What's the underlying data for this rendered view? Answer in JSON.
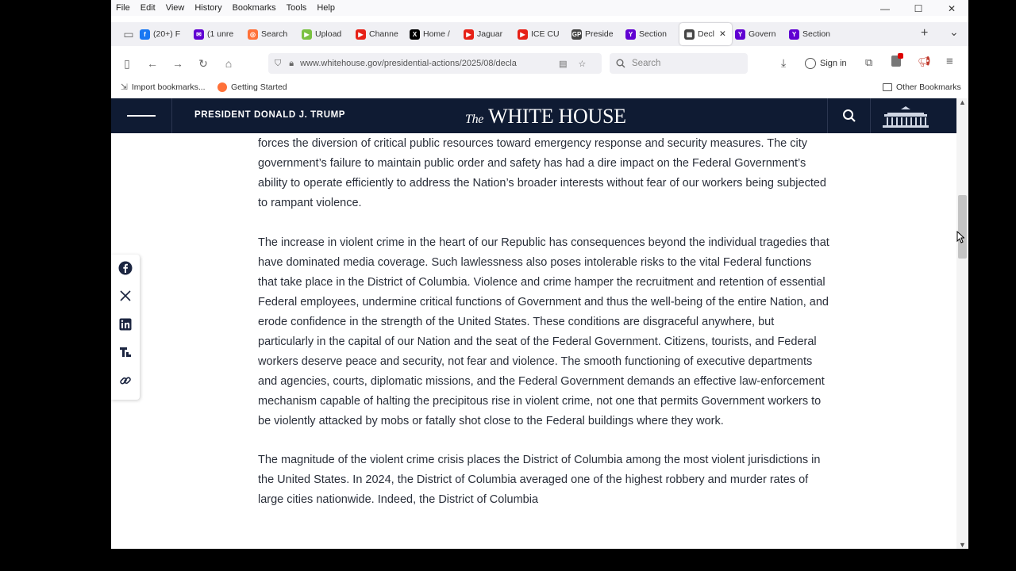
{
  "menubar": [
    "File",
    "Edit",
    "View",
    "History",
    "Bookmarks",
    "Tools",
    "Help"
  ],
  "window_controls": {
    "minimize": "—",
    "maximize": "☐",
    "close": "✕"
  },
  "tabs": [
    {
      "label": "(20+) F",
      "color": "#1877f2",
      "glyph": "f"
    },
    {
      "label": "(1 unre",
      "color": "#6001d2",
      "glyph": "✉"
    },
    {
      "label": "Search",
      "color": "#ff7139",
      "glyph": "◎"
    },
    {
      "label": "Upload",
      "color": "#7ac142",
      "glyph": "▶"
    },
    {
      "label": "Channe",
      "color": "#e62117",
      "glyph": "▶"
    },
    {
      "label": "Home /",
      "color": "#000000",
      "glyph": "X"
    },
    {
      "label": "Jaguar",
      "color": "#e62117",
      "glyph": "▶"
    },
    {
      "label": "ICE CU",
      "color": "#e62117",
      "glyph": "▶"
    },
    {
      "label": "Preside",
      "color": "#444444",
      "glyph": "GP"
    },
    {
      "label": "Section",
      "color": "#6001d2",
      "glyph": "Y"
    },
    {
      "label": "Decl",
      "color": "#444444",
      "glyph": "▦",
      "active": true,
      "close": "✕"
    },
    {
      "label": "Govern",
      "color": "#6001d2",
      "glyph": "Y"
    },
    {
      "label": "Section",
      "color": "#6001d2",
      "glyph": "Y"
    }
  ],
  "tabs_extra": {
    "new_tab": "+",
    "list_tabs": "⌄"
  },
  "navbar": {
    "url": "www.whitehouse.gov/presidential-actions/2025/08/decla",
    "search_placeholder": "Search",
    "sign_in": "Sign in"
  },
  "bookmarks": {
    "import": "Import bookmarks...",
    "getting_started": "Getting Started",
    "other": "Other Bookmarks"
  },
  "site": {
    "president": "PRESIDENT DONALD J. TRUMP",
    "the": "The",
    "title": "WHITE HOUSE"
  },
  "article": {
    "paragraphs": [
      "forces the diversion of critical public resources toward emergency response and security measures.  The city government’s failure to maintain public order and safety has had a dire impact on the Federal Government’s ability to operate efficiently to address the Nation’s broader interests without fear of our workers being subjected to rampant violence.",
      "The increase in violent crime in the heart of our Republic has consequences beyond the individual tragedies that have dominated media coverage.  Such lawlessness also poses intolerable risks to the vital Federal functions that take place in the District of Columbia.  Violence and crime hamper the recruitment and retention of essential Federal employees, undermine critical functions of Government and thus the well-being of the entire Nation, and erode confidence in the strength of the United States.  These conditions are disgraceful anywhere, but particularly in the capital of our Nation and the seat of the Federal Government.  Citizens, tourists, and Federal workers deserve peace and security, not fear and violence.  The smooth functioning of executive departments and agencies, courts, diplomatic missions, and the Federal Government demands an effective law-enforcement mechanism capable of halting the precipitous rise in violent crime, not one that permits Government workers to be violently attacked by mobs or fatally shot close to the Federal buildings where they work.",
      "The magnitude of the violent crime crisis places the District of Columbia among the most violent jurisdictions in the United States.  In 2024, the District of Columbia averaged one of the highest robbery and murder rates of large cities nationwide.  Indeed, the District of Columbia"
    ]
  },
  "share_icons": [
    "facebook-icon",
    "x-icon",
    "linkedin-icon",
    "truth-social-icon",
    "link-icon"
  ]
}
